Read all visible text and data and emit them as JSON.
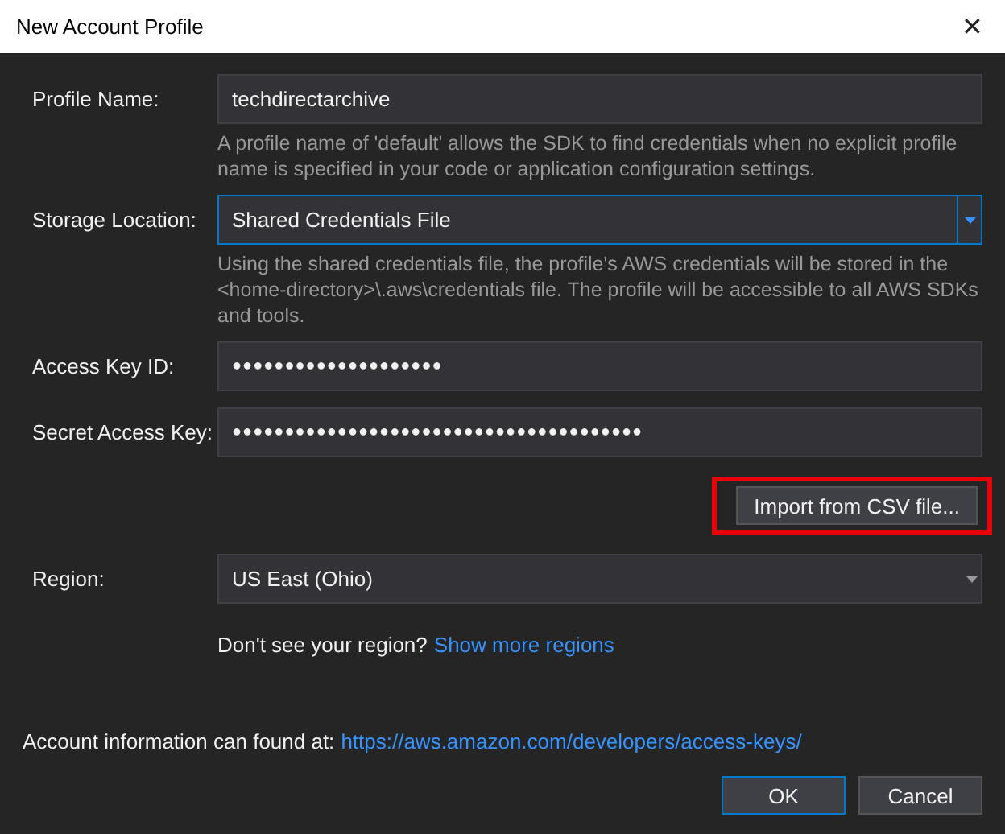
{
  "window": {
    "title": "New Account Profile",
    "close": "✕"
  },
  "fields": [
    {
      "kind": "text",
      "label": "Profile Name:",
      "value": "techdirectarchive",
      "focused": false,
      "help": "A profile name of 'default' allows the SDK to find credentials when no explicit profile name is specified in your code or application configuration settings."
    },
    {
      "kind": "dropdown",
      "label": "Storage Location:",
      "value": "Shared Credentials File",
      "focused": true,
      "help": "Using the shared credentials file, the profile's AWS credentials will be stored in the <home-directory>\\.aws\\credentials file. The profile will be accessible to all AWS SDKs and tools."
    },
    {
      "kind": "password",
      "label": "Access Key ID:",
      "value": "●●●●●●●●●●●●●●●●●●●●",
      "focused": false
    },
    {
      "kind": "password",
      "label": "Secret Access Key:",
      "value": "●●●●●●●●●●●●●●●●●●●●●●●●●●●●●●●●●●●●●●●",
      "focused": false
    },
    {
      "kind": "button",
      "label": "Import from CSV file...",
      "highlighted": true
    },
    {
      "kind": "dropdown",
      "label": "Region:",
      "value": "US East (Ohio)",
      "focused": false,
      "hint": "Don't see your region?",
      "link": "Show more regions"
    }
  ],
  "account_info": {
    "text": "Account information can found at:",
    "link": "https://aws.amazon.com/developers/access-keys/"
  },
  "buttons": [
    {
      "label": "OK",
      "default": true
    },
    {
      "label": "Cancel",
      "default": false
    }
  ]
}
